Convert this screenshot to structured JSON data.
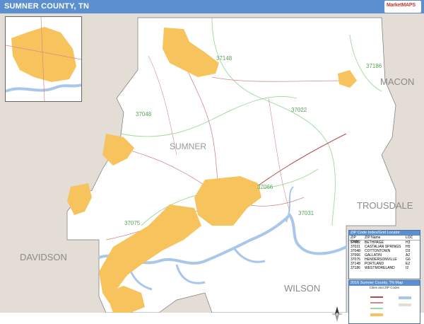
{
  "header": {
    "title": "SUMNER COUNTY, TN",
    "logo_text": "MarketMAPS"
  },
  "map": {
    "county_label": "SUMNER",
    "neighbors": [
      "DAVIDSON",
      "WILSON",
      "TROUSDALE",
      "MACON"
    ],
    "zip_labels": [
      "37148",
      "37186",
      "37022",
      "37048",
      "37066",
      "37031",
      "37075"
    ],
    "colors": {
      "land": "#ffffff",
      "outside": "#e3ddd5",
      "urban": "#f7c35c",
      "water": "#a9c7ea",
      "zip_boundary": "#9fd79f",
      "roads": "#d48a8a",
      "header": "#5b8fd0"
    }
  },
  "locator": {
    "title": "ZIP Code Index/Grid Locator",
    "headers": [
      "ZIP Code",
      "ZIP Name",
      "LOC"
    ],
    "rows": [
      {
        "zip": "37022",
        "name": "BETHPAGE",
        "loc": "H3"
      },
      {
        "zip": "37031",
        "name": "CASTALIAN SPRINGS",
        "loc": "H5"
      },
      {
        "zip": "37048",
        "name": "COTTONTOWN",
        "loc": "D3"
      },
      {
        "zip": "37066",
        "name": "GALLATIN",
        "loc": "A2"
      },
      {
        "zip": "37075",
        "name": "HENDERSONVILLE",
        "loc": "G6"
      },
      {
        "zip": "37148",
        "name": "PORTLAND",
        "loc": "E2"
      },
      {
        "zip": "37186",
        "name": "WESTMORELAND",
        "loc": "I2"
      }
    ]
  },
  "legend": {
    "title": "2016 Sumner County, TN Map",
    "subtitle": "Cities and ZIP Codes"
  }
}
